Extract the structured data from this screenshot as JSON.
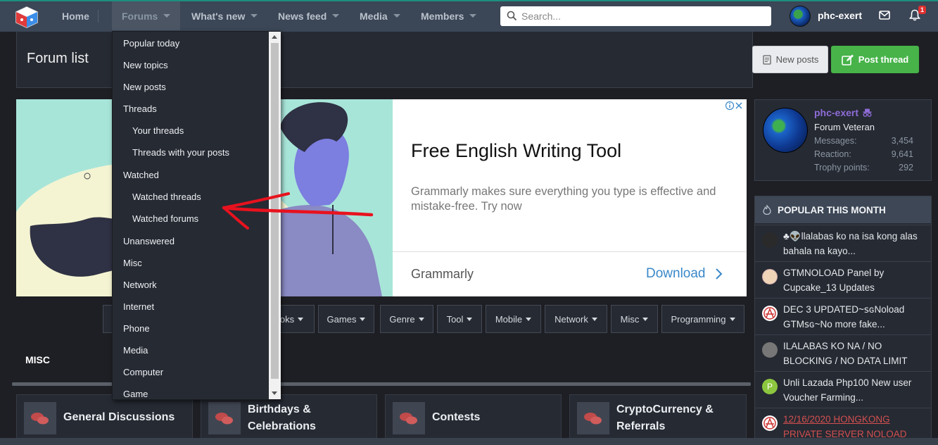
{
  "nav": {
    "items": [
      {
        "label": "Home"
      },
      {
        "label": "Forums"
      },
      {
        "label": "What's new"
      },
      {
        "label": "News feed"
      },
      {
        "label": "Media"
      },
      {
        "label": "Members"
      }
    ],
    "search_placeholder": "Search...",
    "username": "phc-exert",
    "alert_count": "1"
  },
  "page": {
    "title": "Forum list",
    "new_posts_label": "New posts",
    "post_thread_label": "Post thread"
  },
  "ad": {
    "title": "Free English Writing Tool",
    "description": "Grammarly makes sure everything you type is effective and mistake-free. Try now",
    "brand": "Grammarly",
    "cta": "Download"
  },
  "categories": [
    {
      "label": "oks"
    },
    {
      "label": "Games"
    },
    {
      "label": "Genre"
    },
    {
      "label": "Tool"
    },
    {
      "label": "Mobile"
    },
    {
      "label": "Network"
    },
    {
      "label": "Misc"
    },
    {
      "label": "Programming"
    }
  ],
  "section": {
    "heading": "MISC",
    "forums": [
      {
        "title": "General Discussions"
      },
      {
        "title": "Birthdays & Celebrations"
      },
      {
        "title": "Contests"
      },
      {
        "title": "CryptoCurrency & Referrals"
      }
    ]
  },
  "profile": {
    "name": "phc-exert",
    "rank": "Forum Veteran",
    "stats": [
      {
        "label": "Messages:",
        "value": "3,454"
      },
      {
        "label": "Reaction:",
        "value": "9,641"
      },
      {
        "label": "Trophy points:",
        "value": "292"
      }
    ]
  },
  "popular": {
    "heading": "POPULAR THIS MONTH",
    "items": [
      {
        "text": "♣👽llalabas ko na isa kong alas bahala na kayo...",
        "avatar_color": "#2a2a2a"
      },
      {
        "text": "GTMNOLOAD Panel by Cupcake_13 Updates",
        "avatar_color": "#f0d4b8"
      },
      {
        "text": "DEC 3 UPDATED~ꜱɢNoload GTMꜱɢ~No more fake...",
        "avatar_color": "#ffffff"
      },
      {
        "text": "ILALABAS KO NA / NO BLOCKING / NO DATA LIMIT",
        "avatar_color": "#777777"
      },
      {
        "text": "Unli Lazada Php100 New user Voucher Farming...",
        "avatar_color": "#8cc63f",
        "initial": "P"
      },
      {
        "text": "12/16/2020 HONGKONG PRIVATE SERVER NOLOAD",
        "avatar_color": "#ffffff"
      }
    ]
  },
  "dropdown": {
    "items": [
      {
        "label": "Popular today"
      },
      {
        "label": "New topics"
      },
      {
        "label": "New posts"
      },
      {
        "label": "Threads"
      },
      {
        "label": "Your threads"
      },
      {
        "label": "Threads with your posts"
      },
      {
        "label": "Watched"
      },
      {
        "label": "Watched threads"
      },
      {
        "label": "Watched forums"
      },
      {
        "label": "Unanswered"
      },
      {
        "label": "Misc"
      },
      {
        "label": "Network"
      },
      {
        "label": "Internet"
      },
      {
        "label": "Phone"
      },
      {
        "label": "Media"
      },
      {
        "label": "Computer"
      },
      {
        "label": "Game"
      }
    ]
  },
  "colors": {
    "accent_green": "#47b349",
    "nav_bg": "#3b4656",
    "username_purple": "#8e6cd6",
    "annotation_red": "#e8121e"
  }
}
